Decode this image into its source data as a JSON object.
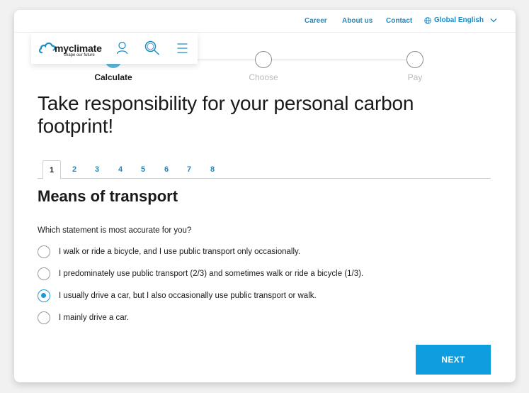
{
  "topnav": {
    "links": [
      "Career",
      "About us",
      "Contact"
    ],
    "language": "Global English"
  },
  "brand": {
    "name": "myclimate",
    "tagline": "shape our future",
    "accent_color": "#1d8bc4"
  },
  "header_icons": [
    "user-icon",
    "search-icon",
    "menu-icon"
  ],
  "stepper": {
    "steps": [
      "Calculate",
      "Choose",
      "Pay"
    ],
    "active_index": 0
  },
  "page_title": "Take responsibility for your personal carbon footprint!",
  "tabs": [
    "1",
    "2",
    "3",
    "4",
    "5",
    "6",
    "7",
    "8"
  ],
  "active_tab": "1",
  "section": {
    "title": "Means of transport",
    "question": "Which statement is most accurate for you?",
    "options": [
      "I walk or ride a bicycle, and I use public transport only occasionally.",
      "I predominately use public transport (2/3) and sometimes walk or ride a bicycle (1/3).",
      "I usually drive a car, but I also occasionally use public transport or walk.",
      "I mainly drive a car."
    ],
    "selected_index": 2
  },
  "next_label": "NEXT",
  "button_color": "#0e9ee0"
}
